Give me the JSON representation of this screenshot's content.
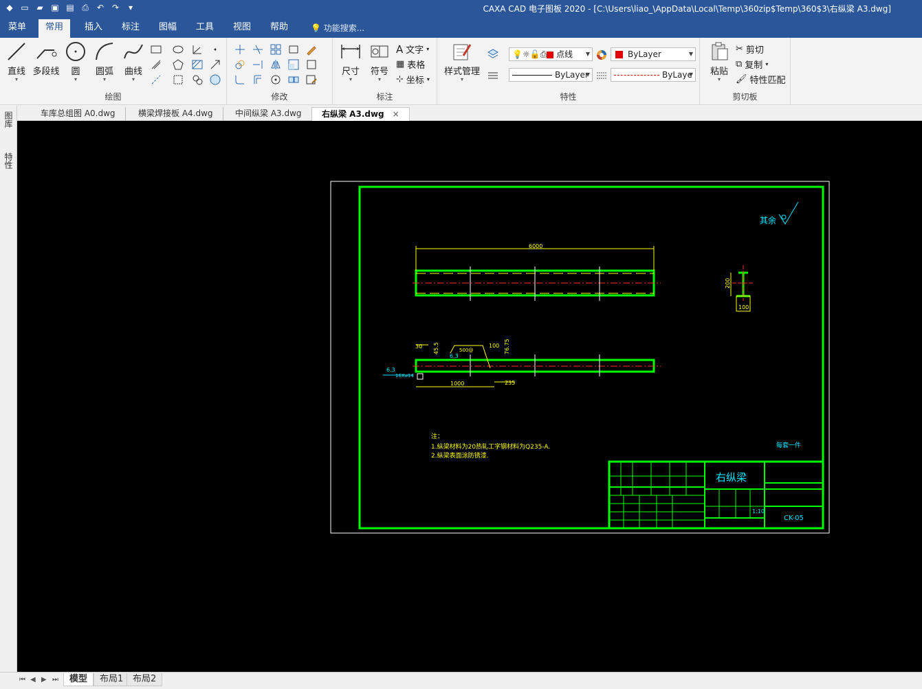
{
  "window": {
    "title": "CAXA CAD 电子图板 2020 - [C:\\Users\\liao_\\AppData\\Local\\Temp\\360zip$Temp\\360$3\\右纵梁 A3.dwg]"
  },
  "menu": {
    "tabs": [
      "菜单",
      "常用",
      "插入",
      "标注",
      "图幅",
      "工具",
      "视图",
      "帮助"
    ],
    "active_tab": "常用",
    "search_placeholder": "功能搜索..."
  },
  "ribbon": {
    "draw": {
      "group_label": "绘图",
      "line": "直线",
      "polyline": "多段线",
      "circle": "圆",
      "arc": "圆弧",
      "curve": "曲线"
    },
    "modify": {
      "group_label": "修改"
    },
    "annotate": {
      "group_label": "标注",
      "dimension": "尺寸",
      "symbol": "符号",
      "text": "文字",
      "table": "表格",
      "coordinate": "坐标"
    },
    "properties": {
      "group_label": "特性",
      "style_manager": "样式管理",
      "layer": "点线",
      "color": "ByLayer",
      "linetype": "ByLayer",
      "lineweight": "ByLaye"
    },
    "clipboard": {
      "group_label": "剪切板",
      "paste": "粘贴",
      "cut": "剪切",
      "copy": "复制",
      "match_props": "特性匹配"
    }
  },
  "documents": {
    "tabs": [
      "车库总组图 A0.dwg",
      "横梁焊接板 A4.dwg",
      "中间纵梁 A3.dwg",
      "右纵梁 A3.dwg"
    ],
    "active": "右纵梁 A3.dwg",
    "close_glyph": "×"
  },
  "side_panels": [
    "图库",
    "特性"
  ],
  "drawing": {
    "roughness_note": "其余",
    "dim_length": "6000",
    "dim_section_height": "200",
    "dim_section_width": "100",
    "dim_30": "30",
    "dim_455": "45.5",
    "dim_100": "100",
    "dim_7675": "76.75",
    "dim_1000": "1000",
    "dim_235": "235",
    "dim_500": "500@",
    "roughness_63a": "6.3",
    "roughness_63b": "6.3",
    "holes": "16X⌀14",
    "notes_title": "注：",
    "note_1": "1.纵梁材料为20热轧工字钢材料为Q235-A.",
    "note_2": "2.纵梁表面涂防锈漆.",
    "quantity_note": "每套一件",
    "title_block_name": "右纵梁",
    "title_block_code": "CK-05",
    "title_block_scale": "1:10"
  },
  "layout": {
    "tabs": [
      "模型",
      "布局1",
      "布局2"
    ],
    "active": "模型"
  }
}
